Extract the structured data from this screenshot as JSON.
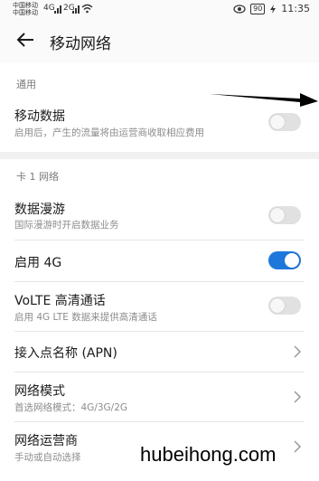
{
  "status_bar": {
    "carrier_1": "中国移动",
    "carrier_2": "中国移动",
    "signal_1": "4G",
    "signal_2": "2G",
    "battery": "90",
    "time": "11:35"
  },
  "header": {
    "title": "移动网络"
  },
  "sections": {
    "general": {
      "heading": "通用",
      "mobile_data": {
        "title": "移动数据",
        "subtitle": "启用后，产生的流量将由运营商收取相应费用",
        "enabled": false
      }
    },
    "card1": {
      "heading": "卡 1 网络",
      "roaming": {
        "title": "数据漫游",
        "subtitle": "国际漫游时开启数据业务",
        "enabled": false
      },
      "enable_4g": {
        "title": "启用 4G",
        "enabled": true
      },
      "volte": {
        "title": "VoLTE 高清通话",
        "subtitle": "启用 4G LTE 数据来提供高清通话",
        "enabled": false
      },
      "apn": {
        "title": "接入点名称 (APN)"
      },
      "network_mode": {
        "title": "网络模式",
        "subtitle": "首选网络模式：4G/3G/2G"
      },
      "operator": {
        "title": "网络运营商",
        "subtitle": "手动或自动选择"
      }
    }
  },
  "watermark": "hubeihong.com",
  "colors": {
    "accent": "#1e78dc",
    "toggle_off": "#e1e1e1",
    "section_gap": "#f0f0f0"
  }
}
